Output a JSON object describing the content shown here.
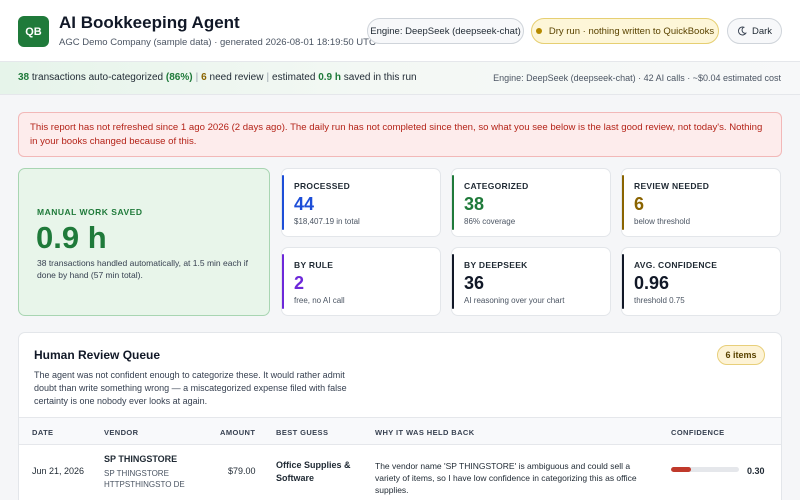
{
  "header": {
    "logo": "QB",
    "title": "AI Bookkeeping Agent",
    "subtitle": "AGC Demo Company (sample data) · generated 2026-08-01 18:19:50 UTC",
    "engine_pill": "Engine: DeepSeek (deepseek-chat)",
    "dry_run_pill": "Dry run · nothing written to QuickBooks",
    "theme_button": "Dark"
  },
  "summary": {
    "count": "38",
    "text_categorized": "transactions auto-categorized",
    "percent": "(86%)",
    "review_count": "6",
    "text_review": "need review",
    "text_estimated": "estimated",
    "hours": "0.9 h",
    "text_saved": "saved in this run",
    "right": "Engine: DeepSeek (deepseek-chat) · 42 AI calls · ~$0.04 estimated cost"
  },
  "alert": {
    "text": "This report has not refreshed since 1 ago 2026 (2 days ago). The daily run has not completed since then, so what you see below is the last good review, not today's. Nothing in your books changed because of this."
  },
  "hero": {
    "label": "MANUAL WORK SAVED",
    "value": "0.9 h",
    "description": "38 transactions handled automatically, at 1.5 min each if done by hand (57 min total)."
  },
  "stats": [
    {
      "label": "PROCESSED",
      "value": "44",
      "sub": "$18,407.19 in total",
      "color": "#1d4ed8"
    },
    {
      "label": "CATEGORIZED",
      "value": "38",
      "sub": "86% coverage",
      "color": "#1f7a3a"
    },
    {
      "label": "REVIEW NEEDED",
      "value": "6",
      "sub": "below threshold",
      "color": "#8a6400"
    },
    {
      "label": "BY RULE",
      "value": "2",
      "sub": "free, no AI call",
      "color": "#6d28d9"
    },
    {
      "label": "BY DEEPSEEK",
      "value": "36",
      "sub": "AI reasoning over your chart",
      "color": "#111827"
    },
    {
      "label": "AVG. CONFIDENCE",
      "value": "0.96",
      "sub": "threshold 0.75",
      "color": "#111827"
    }
  ],
  "queue": {
    "title": "Human Review Queue",
    "badge": "6 items",
    "description": "The agent was not confident enough to categorize these. It would rather admit doubt than write something wrong — a miscategorized expense filed with false certainty is one nobody ever looks at again.",
    "columns": {
      "date": "DATE",
      "vendor": "VENDOR",
      "amount": "AMOUNT",
      "guess": "BEST GUESS",
      "reason": "WHY IT WAS HELD BACK",
      "confidence": "CONFIDENCE"
    },
    "rows": [
      {
        "date": "Jun 21, 2026",
        "vendor": "SP THINGSTORE",
        "vendor_raw_1": "SP THINGSTORE",
        "vendor_raw_2": "HTTPSTHINGSTO DE",
        "amount": "$79.00",
        "guess": "Office Supplies & Software",
        "reason": "The vendor name 'SP THINGSTORE' is ambiguous and could sell a variety of items, so I have low confidence in categorizing this as office supplies.",
        "confidence": "0.30",
        "confidence_fraction": 0.3
      }
    ]
  }
}
